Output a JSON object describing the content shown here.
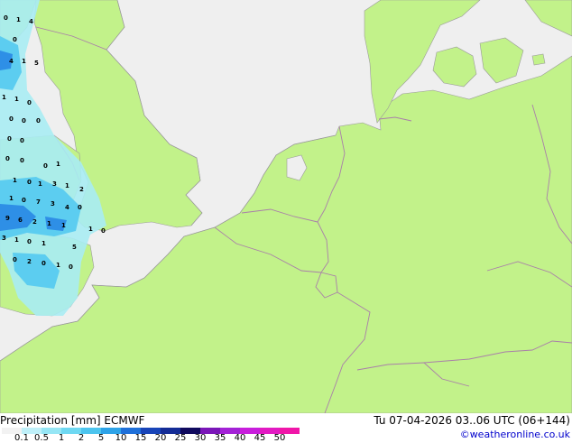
{
  "map": {
    "colors": {
      "sea": "#efefef",
      "land": "#c2f28a",
      "border": "#a97fa9",
      "coast": "#9a9a9a",
      "precip_light": "#a9ecf3",
      "precip_medium": "#5ccdf0",
      "precip_heavy": "#2e8fe6"
    },
    "precip_labels": [
      "0",
      "1",
      "4",
      "0",
      "4",
      "1",
      "5",
      "1",
      "1",
      "0",
      "0",
      "0",
      "0",
      "0",
      "0",
      "0",
      "0",
      "0",
      "1",
      "1",
      "0",
      "1",
      "3",
      "1",
      "2",
      "1",
      "0",
      "7",
      "3",
      "4",
      "0",
      "9",
      "6",
      "2",
      "1",
      "1",
      "1",
      "0",
      "3",
      "1",
      "0",
      "1",
      "5",
      "0",
      "2",
      "0",
      "1",
      "0"
    ]
  },
  "footer": {
    "title": "Precipitation [mm]  ECMWF",
    "run": "Tu 07-04-2026 03..06 UTC (06+144)",
    "credit": "©weatheronline.co.uk"
  },
  "legend": {
    "ticks": [
      "0.1",
      "0.5",
      "1",
      "2",
      "5",
      "10",
      "15",
      "20",
      "25",
      "30",
      "35",
      "40",
      "45",
      "50"
    ],
    "colors": [
      "#f2f2f2",
      "#bff0f9",
      "#96e6f5",
      "#6ed8f2",
      "#4cc4ee",
      "#2ea3e8",
      "#1e6fd9",
      "#1844b8",
      "#142c96",
      "#100a5e",
      "#7a16b8",
      "#a322d6",
      "#c81edc",
      "#e21ac2",
      "#f016a8"
    ]
  }
}
